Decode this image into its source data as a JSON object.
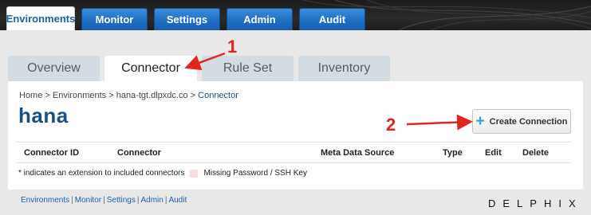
{
  "main_nav": {
    "tabs": [
      {
        "label": "Environments",
        "active": true
      },
      {
        "label": "Monitor",
        "active": false
      },
      {
        "label": "Settings",
        "active": false
      },
      {
        "label": "Admin",
        "active": false
      },
      {
        "label": "Audit",
        "active": false
      }
    ]
  },
  "sub_nav": {
    "tabs": [
      {
        "label": "Overview",
        "active": false
      },
      {
        "label": "Connector",
        "active": true
      },
      {
        "label": "Rule Set",
        "active": false
      },
      {
        "label": "Inventory",
        "active": false
      }
    ]
  },
  "breadcrumb": {
    "home": "Home",
    "sep": " > ",
    "environments": "Environments",
    "host": "hana-tgt.dlpxdc.co",
    "current": "Connector"
  },
  "page": {
    "title": "hana"
  },
  "actions": {
    "create_connection": "Create Connection",
    "create_icon": "plus-icon"
  },
  "table": {
    "columns": [
      "Connector ID",
      "Connector",
      "Meta Data Source",
      "Type",
      "Edit",
      "Delete"
    ],
    "rows": []
  },
  "legend": {
    "extension_note": "* indicates an extension to included connectors",
    "missing_password": "Missing Password / SSH Key",
    "swatch_color": "#f7dede"
  },
  "footer": {
    "links": [
      "Environments",
      "Monitor",
      "Settings",
      "Admin",
      "Audit"
    ],
    "brand": "DELPHIX"
  },
  "annotations": {
    "step1": "1",
    "step2": "2",
    "color": "#e0261e"
  },
  "colors": {
    "accent_blue": "#1f6fc2",
    "title_blue": "#1a4f86",
    "plus_cyan": "#2fa3dc"
  }
}
